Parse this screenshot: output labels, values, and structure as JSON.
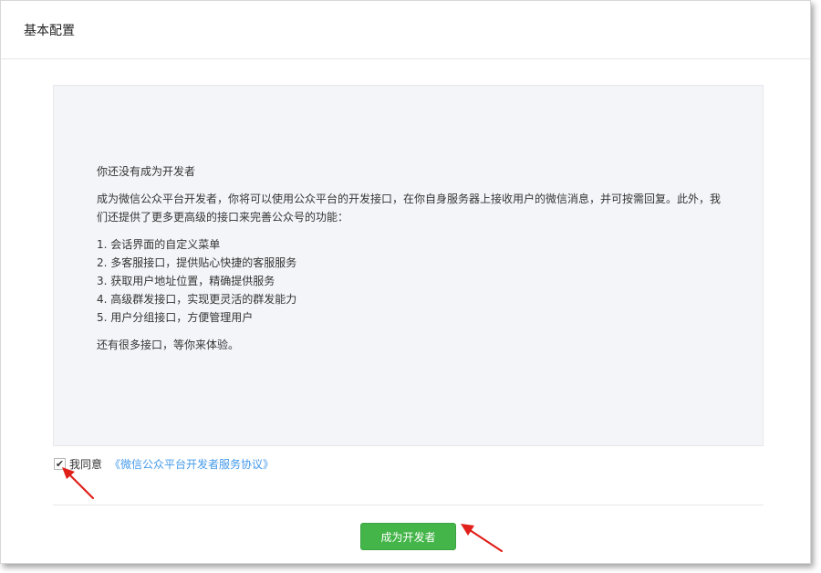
{
  "header": {
    "title": "基本配置"
  },
  "intro": {
    "heading": "你还没有成为开发者",
    "description": "成为微信公众平台开发者，你将可以使用公众平台的开发接口，在你自身服务器上接收用户的微信消息，并可按需回复。此外，我们还提供了更多更高级的接口来完善公众号的功能：",
    "features": [
      "1. 会话界面的自定义菜单",
      "2. 多客服接口，提供贴心快捷的客服服务",
      "3. 获取用户地址位置，精确提供服务",
      "4. 高级群发接口，实现更灵活的群发能力",
      "5. 用户分组接口，方便管理用户"
    ],
    "closing": "还有很多接口，等你来体验。"
  },
  "agreement": {
    "checked": true,
    "check_glyph": "✔",
    "label": "我同意",
    "link_text": "《微信公众平台开发者服务协议》"
  },
  "actions": {
    "become_developer_label": "成为开发者"
  },
  "colors": {
    "accent_green": "#44b549",
    "link_blue": "#459ae9",
    "annotation_red": "#e0201a",
    "panel_bg": "#f4f5f9"
  },
  "icons": {
    "checkmark": "check-icon",
    "annotation": "red-arrow-icon"
  }
}
